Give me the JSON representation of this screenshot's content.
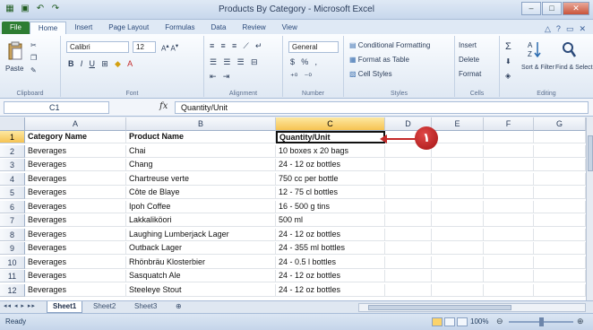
{
  "window": {
    "title": "Products By Category - Microsoft Excel"
  },
  "ribbon_tabs": [
    "File",
    "Home",
    "Insert",
    "Page Layout",
    "Formulas",
    "Data",
    "Review",
    "View"
  ],
  "ribbon": {
    "clipboard": {
      "paste": "Paste",
      "label": "Clipboard"
    },
    "font": {
      "name": "Calibri",
      "size": "12",
      "label": "Font",
      "bold": "B",
      "italic": "I",
      "underline": "U"
    },
    "alignment": {
      "label": "Alignment"
    },
    "number": {
      "format": "General",
      "currency": "$",
      "percent": "%",
      "comma": ",",
      "label": "Number"
    },
    "styles": {
      "conditional": "Conditional Formatting",
      "table": "Format as Table",
      "cell_styles": "Cell Styles",
      "label": "Styles"
    },
    "cells": {
      "insert": "Insert",
      "delete": "Delete",
      "format": "Format",
      "label": "Cells"
    },
    "editing": {
      "sigma": "Σ",
      "sort": "Sort & Filter",
      "find": "Find & Select",
      "label": "Editing"
    }
  },
  "formula_bar": {
    "name_box": "C1",
    "fx": "fx",
    "content": "Quantity/Unit"
  },
  "columns": [
    "A",
    "B",
    "C",
    "D",
    "E",
    "F",
    "G"
  ],
  "rows": [
    {
      "n": "1",
      "a": "Category Name",
      "b": "Product Name",
      "c": "Quantity/Unit"
    },
    {
      "n": "2",
      "a": "Beverages",
      "b": "Chai",
      "c": "10 boxes x 20 bags"
    },
    {
      "n": "3",
      "a": "Beverages",
      "b": "Chang",
      "c": "24 - 12 oz bottles"
    },
    {
      "n": "4",
      "a": "Beverages",
      "b": "Chartreuse verte",
      "c": "750 cc per bottle"
    },
    {
      "n": "5",
      "a": "Beverages",
      "b": "Côte de Blaye",
      "c": "12 - 75 cl bottles"
    },
    {
      "n": "6",
      "a": "Beverages",
      "b": "Ipoh Coffee",
      "c": "16 - 500 g tins"
    },
    {
      "n": "7",
      "a": "Beverages",
      "b": "Lakkaliköori",
      "c": "500 ml"
    },
    {
      "n": "8",
      "a": "Beverages",
      "b": "Laughing Lumberjack Lager",
      "c": "24 - 12 oz bottles"
    },
    {
      "n": "9",
      "a": "Beverages",
      "b": "Outback Lager",
      "c": "24 - 355 ml bottles"
    },
    {
      "n": "10",
      "a": "Beverages",
      "b": "Rhönbräu Klosterbier",
      "c": "24 - 0.5 l bottles"
    },
    {
      "n": "11",
      "a": "Beverages",
      "b": "Sasquatch Ale",
      "c": "24 - 12 oz bottles"
    },
    {
      "n": "12",
      "a": "Beverages",
      "b": "Steeleye Stout",
      "c": "24 - 12 oz bottles"
    }
  ],
  "callout": {
    "number": "١",
    "color": "#c42a2a"
  },
  "sheets": [
    "Sheet1",
    "Sheet2",
    "Sheet3"
  ],
  "status": {
    "ready": "Ready",
    "zoom": "100%"
  },
  "colors": {
    "accent": "#2e7d32",
    "selection_header": "#f6c352",
    "ribbon": "#dfe9f5"
  }
}
